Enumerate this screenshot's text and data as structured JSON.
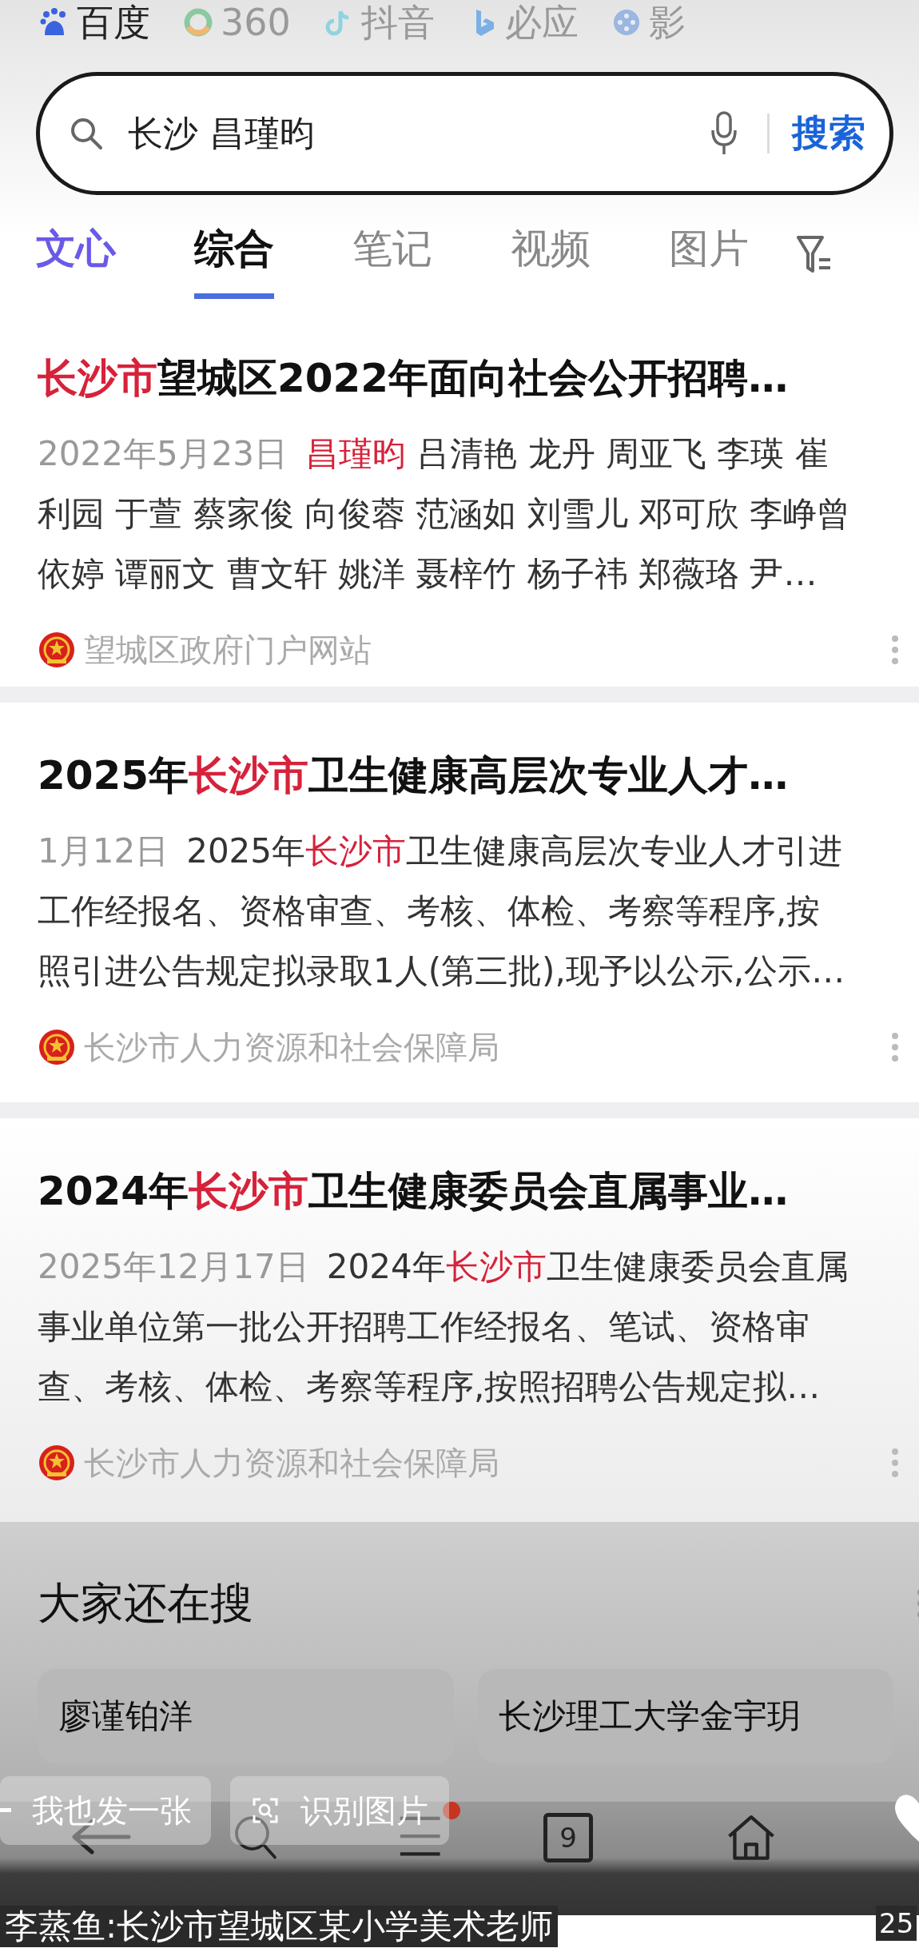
{
  "engines": [
    {
      "label": "百度",
      "selected": true
    },
    {
      "label": "360",
      "selected": false
    },
    {
      "label": "抖音",
      "selected": false
    },
    {
      "label": "必应",
      "selected": false
    },
    {
      "label": "影",
      "selected": false
    }
  ],
  "search": {
    "value": "长沙 昌瑾昀",
    "button": "搜索"
  },
  "tabs": [
    {
      "label": "文心",
      "kind": "ai",
      "selected": false
    },
    {
      "label": "综合",
      "kind": "plain",
      "selected": true
    },
    {
      "label": "笔记",
      "kind": "plain",
      "selected": false
    },
    {
      "label": "视频",
      "kind": "plain",
      "selected": false
    },
    {
      "label": "图片",
      "kind": "plain",
      "selected": false
    }
  ],
  "results": [
    {
      "title": [
        {
          "text": "长沙市",
          "highlight": true
        },
        {
          "text": "望城区2022年面向社会公开招聘…",
          "highlight": false
        }
      ],
      "date": "2022年5月23日",
      "snippet": [
        {
          "text": "昌瑾昀",
          "highlight": true
        },
        {
          "text": " 吕清艳 龙丹 周亚飞 李瑛 崔利园 于萱 蔡家俊 向俊蓉 范涵如 刘雪儿 邓可欣 李峥曾依婷 谭丽文 曹文轩 姚洋 聂梓竹 杨子祎 郑薇珞 尹…",
          "highlight": false
        }
      ],
      "source": "望城区政府门户网站"
    },
    {
      "title": [
        {
          "text": "2025年",
          "highlight": false
        },
        {
          "text": "长沙市",
          "highlight": true
        },
        {
          "text": "卫生健康高层次专业人才…",
          "highlight": false
        }
      ],
      "date": "1月12日",
      "snippet": [
        {
          "text": "2025年",
          "highlight": false
        },
        {
          "text": "长沙市",
          "highlight": true
        },
        {
          "text": "卫生健康高层次专业人才引进工作经报名、资格审查、考核、体检、考察等程序,按照引进公告规定拟录取1人(第三批),现予以公示,公示…",
          "highlight": false
        }
      ],
      "source": "长沙市人力资源和社会保障局"
    },
    {
      "title": [
        {
          "text": "2024年",
          "highlight": false
        },
        {
          "text": "长沙市",
          "highlight": true
        },
        {
          "text": "卫生健康委员会直属事业…",
          "highlight": false
        }
      ],
      "date": "2025年12月17日",
      "snippet": [
        {
          "text": "2024年",
          "highlight": false
        },
        {
          "text": "长沙市",
          "highlight": true
        },
        {
          "text": "卫生健康委员会直属事业单位第一批公开招聘工作经报名、笔试、资格审查、考核、体检、考察等程序,按照招聘公告规定拟…",
          "highlight": false
        }
      ],
      "source": "长沙市人力资源和社会保障局"
    }
  ],
  "related": {
    "title": "大家还在搜",
    "items": [
      "廖谨铂洋",
      "长沙理工大学金宇玥"
    ]
  },
  "overlay": {
    "actions": [
      "我也发一张",
      "识别图片"
    ],
    "caption": "李蒸鱼:长沙市望城区某小学美术老师",
    "likes": "25"
  },
  "nav": {
    "menu_badge": true,
    "tab_count": "9"
  }
}
